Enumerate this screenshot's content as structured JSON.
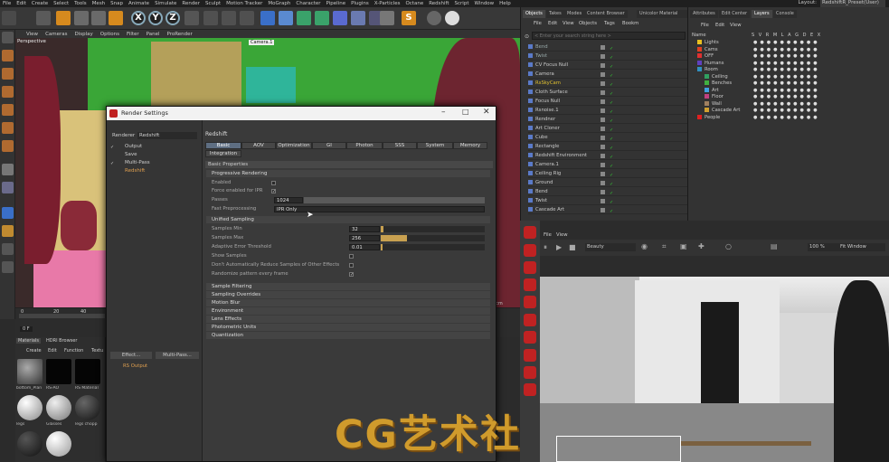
{
  "menubar": {
    "items": [
      "File",
      "Edit",
      "Create",
      "Select",
      "Tools",
      "Mesh",
      "Snap",
      "Animate",
      "Simulate",
      "Render",
      "Sculpt",
      "Motion Tracker",
      "MoGraph",
      "Character",
      "Pipeline",
      "Plugins",
      "X-Particles",
      "Octane",
      "Redshift",
      "Script",
      "Window",
      "Help"
    ],
    "layout_label": "Layout:",
    "layout_value": "RedshiftR_Preset(User)"
  },
  "toolbar": {
    "axes": [
      "X",
      "Y",
      "Z"
    ]
  },
  "viewport": {
    "menu": [
      "View",
      "Cameras",
      "Display",
      "Options",
      "Filter",
      "Panel",
      "ProRender"
    ],
    "label": "Perspective",
    "camera": "Camera.1"
  },
  "timeline": {
    "ticks": [
      "0",
      "20",
      "40"
    ],
    "frame": "0 F",
    "end": "200 cm"
  },
  "materials": {
    "tabs": [
      "Materials",
      "HDRI Browser"
    ],
    "menu": [
      "Create",
      "Edit",
      "Function",
      "Textu"
    ],
    "items": [
      "bottom_Plan",
      "RS-AO",
      "RS Material",
      "legs",
      "Glasses",
      "legs chopp",
      "",
      ""
    ]
  },
  "dialog": {
    "title": "Render Settings",
    "renderer_label": "Renderer",
    "renderer_value": "Redshift",
    "left_tree": [
      "Output",
      "Save",
      "Multi-Pass",
      "Redshift"
    ],
    "effect_button": "Effect...",
    "multipass_button": "Multi-Pass...",
    "rs_output": "RS Output",
    "header": "Redshift",
    "tabs": [
      "Basic",
      "AOV",
      "Optimization",
      "GI",
      "Photon",
      "SSS",
      "System",
      "Memory"
    ],
    "tab2": "Integration",
    "basic_properties": "Basic Properties",
    "progressive": {
      "title": "Progressive Rendering",
      "enabled": "Enabled",
      "force": "Force enabled for IPR",
      "passes_label": "Passes",
      "passes_value": "1024",
      "fast_label": "Fast Preprocessing",
      "fast_value": "IPR Only"
    },
    "unified": {
      "title": "Unified Sampling",
      "min_label": "Samples Min",
      "min_value": "32",
      "max_label": "Samples Max",
      "max_value": "256",
      "adaptive_label": "Adaptive Error Threshold",
      "adaptive_value": "0.01",
      "show": "Show Samples",
      "dont": "Don't Automatically Reduce Samples of Other Effects",
      "randomize": "Randomize pattern every frame",
      "min_fill": 0.03,
      "max_fill": 0.25,
      "adaptive_fill": 0.01
    },
    "collapsed": [
      "Sample Filtering",
      "Sampling Overrides",
      "Motion Blur",
      "Environment",
      "Lens Effects",
      "Photometric Units",
      "Quantization"
    ]
  },
  "objects": {
    "tabs": [
      "Objects",
      "Takes",
      "Modes",
      "Content Browser",
      "Unicolor Material"
    ],
    "menu": [
      "File",
      "Edit",
      "View",
      "Objects",
      "Tags",
      "Bookm"
    ],
    "search_placeholder": "< Enter your search string here >",
    "rows": [
      {
        "name": "Bend",
        "color": "#9aa"
      },
      {
        "name": "Twist",
        "color": "#9aa"
      },
      {
        "name": "CV Focus Null",
        "color": "#ccc"
      },
      {
        "name": "Camera",
        "color": "#ccc"
      },
      {
        "name": "RsSkyCam",
        "color": "#e0c030"
      },
      {
        "name": "Cloth Surface",
        "color": "#ccc"
      },
      {
        "name": "Focus Null",
        "color": "#ccc"
      },
      {
        "name": "Rsnoise.1",
        "color": "#ccc"
      },
      {
        "name": "Rendner",
        "color": "#ccc"
      },
      {
        "name": "Art Cloner",
        "color": "#ccc"
      },
      {
        "name": "Cube",
        "color": "#ccc"
      },
      {
        "name": "Rectangle",
        "color": "#ccc"
      },
      {
        "name": "Redshift Environment",
        "color": "#ccc"
      },
      {
        "name": "Camera.1",
        "color": "#ccc"
      },
      {
        "name": "Ceiling Rig",
        "color": "#ccc"
      },
      {
        "name": "Ground",
        "color": "#ccc"
      },
      {
        "name": "Bend",
        "color": "#ccc"
      },
      {
        "name": "Twist",
        "color": "#ccc"
      },
      {
        "name": "Cascade Art",
        "color": "#ccc"
      }
    ]
  },
  "layers": {
    "tabs": [
      "Attributes",
      "Edit Center",
      "Layers",
      "Console"
    ],
    "menu": [
      "File",
      "Edit",
      "View"
    ],
    "header": "Name",
    "cols": "S V R M L A G D E X",
    "rows": [
      {
        "name": "Lights",
        "color": "#e8c020"
      },
      {
        "name": "Cams",
        "color": "#e04020"
      },
      {
        "name": "OFF",
        "color": "#e03030"
      },
      {
        "name": "Humans",
        "color": "#6040c0"
      },
      {
        "name": "Room",
        "color": "#3090c0"
      },
      {
        "name": "Ceiling",
        "color": "#30a060"
      },
      {
        "name": "Benches",
        "color": "#40b040"
      },
      {
        "name": "Art",
        "color": "#40a0e0"
      },
      {
        "name": "Floor",
        "color": "#c04080"
      },
      {
        "name": "Wall",
        "color": "#a08060"
      },
      {
        "name": "Cascade Art",
        "color": "#d0a030"
      },
      {
        "name": "People",
        "color": "#e02020"
      }
    ]
  },
  "renderview": {
    "menu": [
      "File",
      "View"
    ],
    "aov": "Beauty",
    "zoom": "100 %",
    "fit": "Fit Window"
  },
  "watermark": "CG艺术社",
  "colors": {
    "accent": "#5e6e82",
    "rs_red": "#c02222",
    "viewport_green": "#3aa637"
  }
}
